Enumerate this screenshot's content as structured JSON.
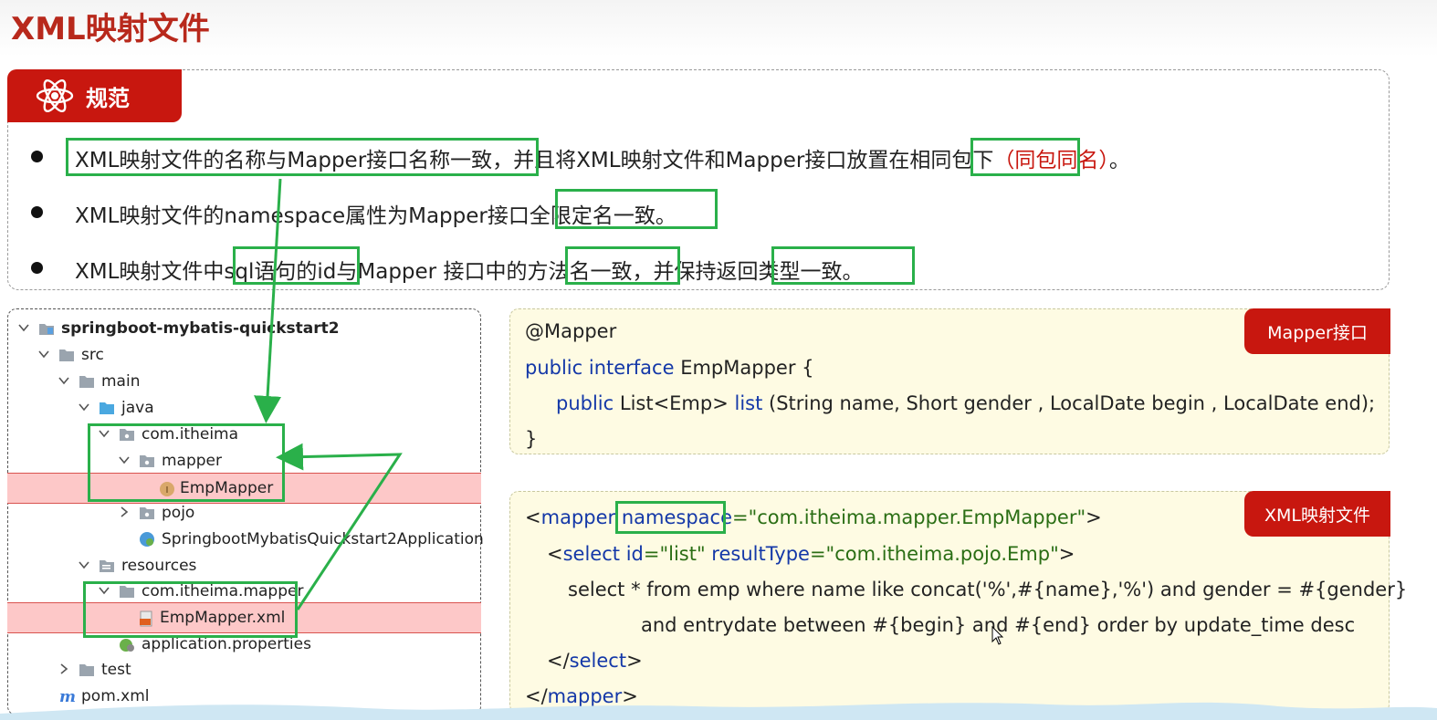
{
  "slide": {
    "title": "XML映射文件"
  },
  "rules": {
    "tab_label": "规范",
    "tab_icon": "atom-icon",
    "bullets": [
      {
        "parts": [
          {
            "text": "XML映射文件的名称与Mapper接口名称一致，",
            "color": "normal"
          },
          {
            "text": "并且将XML映射文件和Mapper接口放置在",
            "color": "normal"
          },
          {
            "text": "相同包下",
            "color": "normal"
          },
          {
            "text": "（同包同名）",
            "color": "red"
          },
          {
            "text": "。",
            "color": "normal"
          }
        ]
      },
      {
        "parts": [
          {
            "text": "XML映射文件的namespace属性为Mapper接口",
            "color": "normal"
          },
          {
            "text": "全限定名一致。",
            "color": "normal"
          }
        ]
      },
      {
        "parts": [
          {
            "text": "XML映射文件中",
            "color": "normal"
          },
          {
            "text": "sql语句的id",
            "color": "normal"
          },
          {
            "text": "与Mapper 接口中的",
            "color": "normal"
          },
          {
            "text": "方法名一致",
            "color": "normal"
          },
          {
            "text": "，并保持",
            "color": "normal"
          },
          {
            "text": "返回类型一致。",
            "color": "normal"
          }
        ]
      }
    ]
  },
  "project_tree": {
    "items": [
      {
        "label": "springboot-mybatis-quickstart2",
        "icon": "project-folder-icon",
        "expanded": true,
        "bold": true,
        "highlight": false
      },
      {
        "label": "src",
        "icon": "folder-icon",
        "expanded": true,
        "highlight": false
      },
      {
        "label": "main",
        "icon": "folder-icon",
        "expanded": true,
        "highlight": false
      },
      {
        "label": "java",
        "icon": "source-folder-icon",
        "expanded": true,
        "highlight": false
      },
      {
        "label": "com.itheima",
        "icon": "package-icon",
        "expanded": true,
        "highlight": false
      },
      {
        "label": "mapper",
        "icon": "package-icon",
        "expanded": true,
        "highlight": false
      },
      {
        "label": "EmpMapper",
        "icon": "interface-icon",
        "expanded": null,
        "highlight": true
      },
      {
        "label": "pojo",
        "icon": "package-icon",
        "expanded": false,
        "highlight": false
      },
      {
        "label": "SpringbootMybatisQuickstart2Application",
        "icon": "spring-class-icon",
        "expanded": null,
        "highlight": false
      },
      {
        "label": "resources",
        "icon": "resources-folder-icon",
        "expanded": true,
        "highlight": false
      },
      {
        "label": "com.itheima.mapper",
        "icon": "folder-icon",
        "expanded": true,
        "highlight": false
      },
      {
        "label": "EmpMapper.xml",
        "icon": "xml-file-icon",
        "expanded": null,
        "highlight": true
      },
      {
        "label": "application.properties",
        "icon": "properties-file-icon",
        "expanded": null,
        "highlight": false
      },
      {
        "label": "test",
        "icon": "folder-icon",
        "expanded": false,
        "highlight": false
      },
      {
        "label": "pom.xml",
        "icon": "maven-icon",
        "expanded": null,
        "highlight": false
      }
    ]
  },
  "mapper_code": {
    "tab_label": "Mapper接口",
    "annotation": "@Mapper",
    "line2_kw": "public interface",
    "line2_rest": " EmpMapper {",
    "line3_kw": "public",
    "line3_type": " List<Emp> ",
    "line3_method": "list",
    "line3_rest": " (String name, Short gender , LocalDate begin , LocalDate end);",
    "line4": "}"
  },
  "xml_code": {
    "tab_label": "XML映射文件",
    "l1_open": "<",
    "l1_tag": "mapper",
    "l1_attr": " namespace",
    "l1_val": "=\"com.itheima.mapper.EmpMapper\"",
    "l1_close": ">",
    "l2_open": "<",
    "l2_tag": "select",
    "l2_attr1": " id",
    "l2_val1": "=\"list\"",
    "l2_attr2": " resultType",
    "l2_val2": "=\"com.itheima.pojo.Emp\"",
    "l2_close": ">",
    "l3": "select * from emp where name like concat('%',#{name},'%') and gender = #{gender}",
    "l4": "and entrydate between #{begin} and #{end} order by update_time desc",
    "l5_open": "</",
    "l5_tag": "select",
    "l5_close": ">",
    "l6_open": "</",
    "l6_tag": "mapper",
    "l6_close": ">"
  },
  "colors": {
    "accent_red": "#c8170f",
    "highlight_green": "#2ab04a",
    "keyword_blue": "#1438a8",
    "code_bg": "#fefbe3"
  }
}
